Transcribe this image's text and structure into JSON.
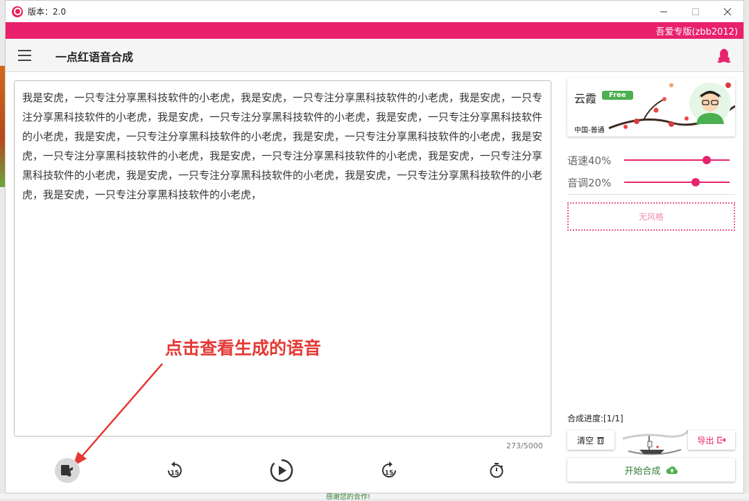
{
  "window": {
    "title": "版本：2.0",
    "edition": "吾爱专版(zbb2012)"
  },
  "appbar": {
    "title": "一点红语音合成"
  },
  "editor": {
    "text": "我是安虎，一只专注分享黑科技软件的小老虎，我是安虎，一只专注分享黑科技软件的小老虎，我是安虎，一只专注分享黑科技软件的小老虎，我是安虎，一只专注分享黑科技软件的小老虎，我是安虎，一只专注分享黑科技软件的小老虎，我是安虎，一只专注分享黑科技软件的小老虎，我是安虎，一只专注分享黑科技软件的小老虎，我是安虎，一只专注分享黑科技软件的小老虎，我是安虎，一只专注分享黑科技软件的小老虎，我是安虎，一只专注分享黑科技软件的小老虎，我是安虎，一只专注分享黑科技软件的小老虎，我是安虎，一只专注分享黑科技软件的小老虎，我是安虎，一只专注分享黑科技软件的小老虎，",
    "counter": "273/5000"
  },
  "annotation": {
    "text": "点击查看生成的语音"
  },
  "controls": {
    "rewind_label": "15",
    "forward_label": "15"
  },
  "voice": {
    "name": "云霞",
    "badge": "Free",
    "region": "中国-普通"
  },
  "sliders": {
    "speed": {
      "label": "语速40%",
      "value": 0.4
    },
    "pitch": {
      "label": "音调20%",
      "value": 0.2
    }
  },
  "style": {
    "label": "无风格"
  },
  "synthesis": {
    "progress": "合成进度:[1/1]",
    "clear_label": "清空",
    "export_label": "导出",
    "start_label": "开始合成"
  },
  "background": {
    "bottom_text": "感谢您的合作!"
  },
  "colors": {
    "accent": "#e9206b",
    "annotation": "#e53935",
    "success": "#4caf50"
  }
}
